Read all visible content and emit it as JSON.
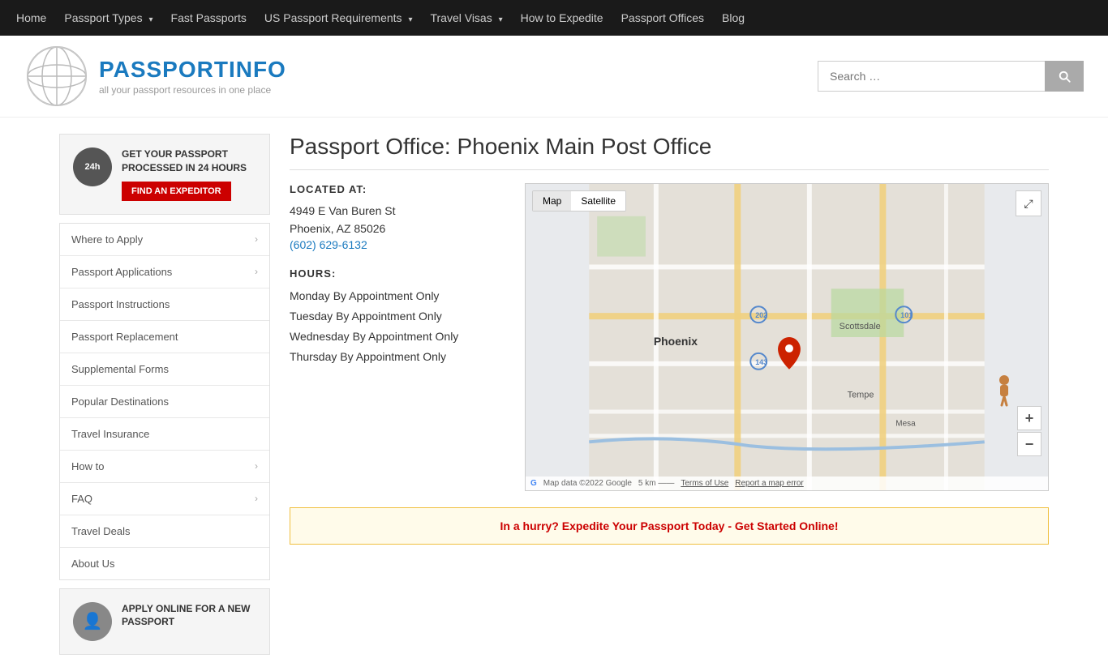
{
  "topnav": {
    "items": [
      {
        "label": "Home",
        "href": "#",
        "dropdown": false
      },
      {
        "label": "Passport Types",
        "href": "#",
        "dropdown": true
      },
      {
        "label": "Fast Passports",
        "href": "#",
        "dropdown": false
      },
      {
        "label": "US Passport Requirements",
        "href": "#",
        "dropdown": true
      },
      {
        "label": "Travel Visas",
        "href": "#",
        "dropdown": true
      },
      {
        "label": "How to Expedite",
        "href": "#",
        "dropdown": false
      },
      {
        "label": "Passport Offices",
        "href": "#",
        "dropdown": false
      },
      {
        "label": "Blog",
        "href": "#",
        "dropdown": false
      }
    ]
  },
  "header": {
    "logo_name_plain": "PASSPORT",
    "logo_name_colored": "INFO",
    "logo_tagline": "all your passport resources in one place",
    "search_placeholder": "Search …"
  },
  "sidebar": {
    "promo1": {
      "icon_label": "24h",
      "text": "GET YOUR PASSPORT PROCESSED IN 24 HOURS",
      "button_label": "FIND AN EXPEDITOR"
    },
    "nav_items": [
      {
        "label": "Where to Apply",
        "dropdown": true
      },
      {
        "label": "Passport Applications",
        "dropdown": true
      },
      {
        "label": "Passport Instructions",
        "dropdown": false
      },
      {
        "label": "Passport Replacement",
        "dropdown": false
      },
      {
        "label": "Supplemental Forms",
        "dropdown": false
      },
      {
        "label": "Popular Destinations",
        "dropdown": false
      },
      {
        "label": "Travel Insurance",
        "dropdown": false
      },
      {
        "label": "How to",
        "dropdown": true
      },
      {
        "label": "FAQ",
        "dropdown": true
      },
      {
        "label": "Travel Deals",
        "dropdown": false
      },
      {
        "label": "About Us",
        "dropdown": false
      }
    ],
    "promo2": {
      "icon": "👤",
      "text": "APPLY ONLINE FOR A NEW PASSPORT"
    }
  },
  "main": {
    "page_title": "Passport Office: Phoenix Main Post Office",
    "located_at_label": "LOCATED AT:",
    "address_line1": "4949 E Van Buren St",
    "address_line2": "Phoenix, AZ 85026",
    "phone": "(602) 629-6132",
    "hours_label": "HOURS:",
    "hours": [
      "Monday By Appointment Only",
      "Tuesday By Appointment Only",
      "Wednesday By Appointment Only",
      "Thursday By Appointment Only"
    ],
    "map_tab_map": "Map",
    "map_tab_satellite": "Satellite",
    "map_fullscreen_icon": "⤢",
    "map_zoom_in": "+",
    "map_zoom_out": "−",
    "map_footer": "Google    Map data ©2022 Google    5 km    Terms of Use    Report a map error",
    "bottom_banner": "In a hurry? Expedite Your Passport Today - Get Started Online!"
  }
}
